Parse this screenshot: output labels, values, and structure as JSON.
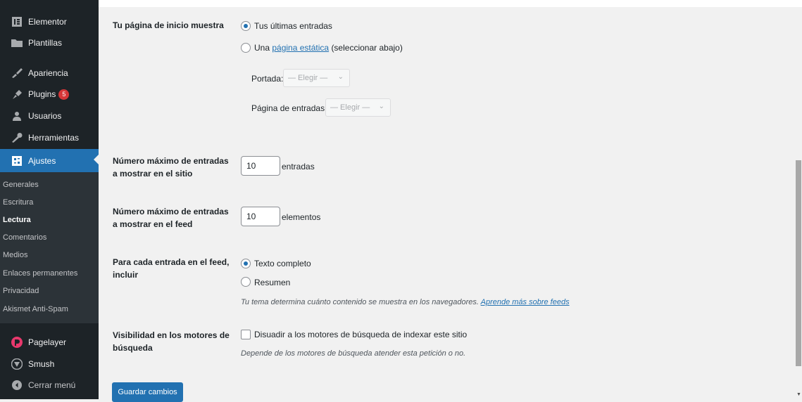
{
  "sidebar": {
    "items": [
      {
        "label": "Elementor",
        "icon": "elementor-icon"
      },
      {
        "label": "Plantillas",
        "icon": "folder-icon"
      },
      {
        "label": "Apariencia",
        "icon": "paintbrush-icon"
      },
      {
        "label": "Plugins",
        "icon": "plugin-icon",
        "badge": "5"
      },
      {
        "label": "Usuarios",
        "icon": "user-icon"
      },
      {
        "label": "Herramientas",
        "icon": "wrench-icon"
      },
      {
        "label": "Ajustes",
        "icon": "settings-icon"
      },
      {
        "label": "Pagelayer",
        "icon": "pagelayer-icon"
      },
      {
        "label": "Smush",
        "icon": "smush-icon"
      },
      {
        "label": "Cerrar menú",
        "icon": "collapse-icon"
      }
    ],
    "submenu": [
      "Generales",
      "Escritura",
      "Lectura",
      "Comentarios",
      "Medios",
      "Enlaces permanentes",
      "Privacidad",
      "Akismet Anti-Spam"
    ],
    "accent": "#2271b1"
  },
  "homepage": {
    "label": "Tu página de inicio muestra",
    "option_latest": "Tus últimas entradas",
    "option_static_prefix": "Una",
    "option_static_link": "página estática",
    "option_static_suffix": "(seleccionar abajo)",
    "portada_label": "Portada:",
    "entradas_label": "Página de entradas:",
    "select_placeholder": "— Elegir —",
    "selected": "latest"
  },
  "posts_per_page": {
    "label": "Número máximo de entradas a mostrar en el sitio",
    "value": "10",
    "unit": "entradas"
  },
  "posts_per_rss": {
    "label": "Número máximo de entradas a mostrar en el feed",
    "value": "10",
    "unit": "elementos"
  },
  "feed_content": {
    "label": "Para cada entrada en el feed, incluir",
    "option_full": "Texto completo",
    "option_summary": "Resumen",
    "selected": "full",
    "desc": "Tu tema determina cuánto contenido se muestra en los navegadores.",
    "desc_link": "Aprende más sobre feeds"
  },
  "visibility": {
    "label": "Visibilidad en los motores de búsqueda",
    "checkbox_label": "Disuadir a los motores de búsqueda de indexar este sitio",
    "checked": false,
    "desc": "Depende de los motores de búsqueda atender esta petición o no."
  },
  "save_label": "Guardar cambios"
}
